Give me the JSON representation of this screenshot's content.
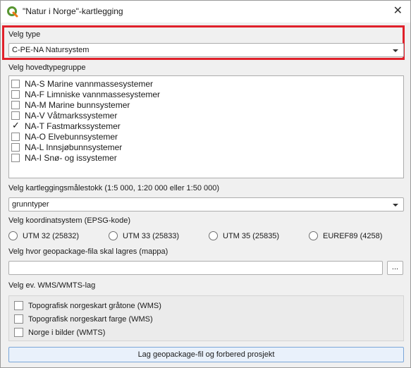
{
  "window": {
    "title": "\"Natur i Norge\"-kartlegging",
    "close_glyph": "✕"
  },
  "type_section": {
    "label": "Velg type",
    "selected": "C-PE-NA Natursystem"
  },
  "hovedtype_section": {
    "label": "Velg hovedtypegruppe",
    "items": [
      {
        "label": "NA-S Marine vannmassesystemer",
        "checked": false
      },
      {
        "label": "NA-F Limniske vannmassesystemer",
        "checked": false
      },
      {
        "label": "NA-M Marine bunnsystemer",
        "checked": false
      },
      {
        "label": "NA-V Våtmarkssystemer",
        "checked": false
      },
      {
        "label": "NA-T Fastmarkssystemer",
        "checked": true
      },
      {
        "label": "NA-O Elvebunnsystemer",
        "checked": false
      },
      {
        "label": "NA-L Innsjøbunnsystemer",
        "checked": false
      },
      {
        "label": "NA-I Snø- og issystemer",
        "checked": false
      }
    ],
    "check_glyph": "✓"
  },
  "scale_section": {
    "label": "Velg kartleggingsmålestokk (1:5 000, 1:20 000 eller 1:50 000)",
    "selected": "grunntyper"
  },
  "crs_section": {
    "label": "Velg koordinatsystem (EPSG-kode)",
    "options": [
      "UTM 32 (25832)",
      "UTM 33 (25833)",
      "UTM 35 (25835)",
      "EUREF89 (4258)"
    ]
  },
  "path_section": {
    "label": "Velg hvor geopackage-fila skal lagres (mappa)",
    "value": "",
    "browse_label": "..."
  },
  "wms_section": {
    "label": "Velg ev. WMS/WMTS-lag",
    "items": [
      "Topografisk norgeskart gråtone (WMS)",
      "Topografisk norgeskart farge (WMS)",
      "Norge i bilder (WMTS)"
    ]
  },
  "action_button": {
    "label": "Lag geopackage-fil og forbered prosjekt"
  },
  "colors": {
    "highlight": "#e0202a",
    "qgis_green": "#589632",
    "qgis_yellow": "#ee7913"
  }
}
